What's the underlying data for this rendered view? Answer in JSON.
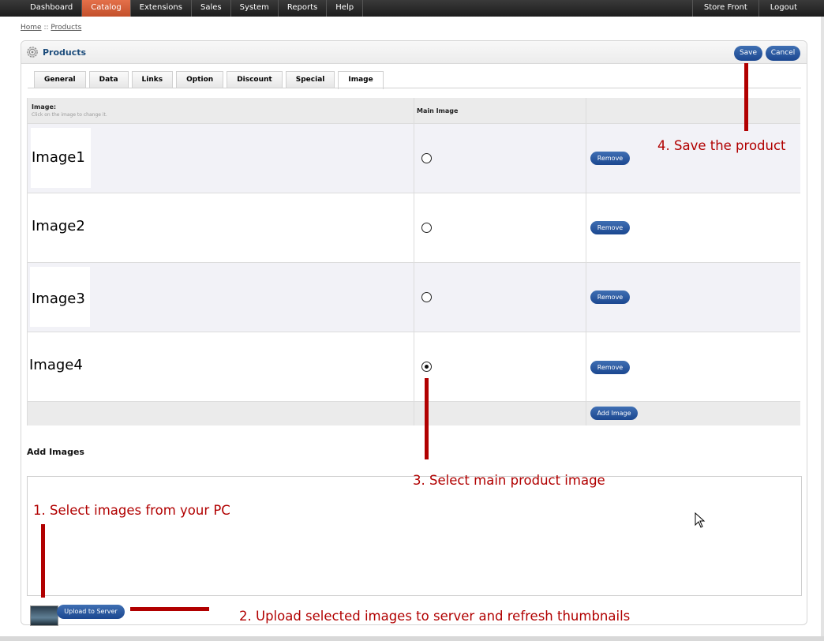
{
  "nav": {
    "items": [
      "Dashboard",
      "Catalog",
      "Extensions",
      "Sales",
      "System",
      "Reports",
      "Help"
    ],
    "active_index": 1,
    "right_items": [
      "Store Front",
      "Logout"
    ]
  },
  "breadcrumb": {
    "home": "Home",
    "separator": "::",
    "current": "Products"
  },
  "box": {
    "title": "Products",
    "icon": "gear-icon",
    "save_label": "Save",
    "cancel_label": "Cancel"
  },
  "tabs": [
    "General",
    "Data",
    "Links",
    "Option",
    "Discount",
    "Special",
    "Image"
  ],
  "active_tab_index": 6,
  "table": {
    "header_image": "Image:",
    "header_hint": "Click on the image to change it.",
    "header_main": "Main Image",
    "rows": [
      {
        "label": "Image1",
        "main": false,
        "remove_label": "Remove"
      },
      {
        "label": "Image2",
        "main": false,
        "remove_label": "Remove"
      },
      {
        "label": "Image3",
        "main": false,
        "remove_label": "Remove"
      },
      {
        "label": "Image4",
        "main": true,
        "remove_label": "Remove"
      }
    ],
    "add_image_label": "Add Image"
  },
  "add_images": {
    "title": "Add Images",
    "upload_label": "Upload to Server"
  },
  "annotations": {
    "step1": "1. Select images from your PC",
    "step2": "2. Upload selected images to server and refresh thumbnails",
    "step3": "3. Select main product image",
    "step4": "4. Save the product"
  },
  "colors": {
    "accent_blue": "#1b4790",
    "active_tab_orange": "#d65f38",
    "annotation_red": "#b10000"
  }
}
